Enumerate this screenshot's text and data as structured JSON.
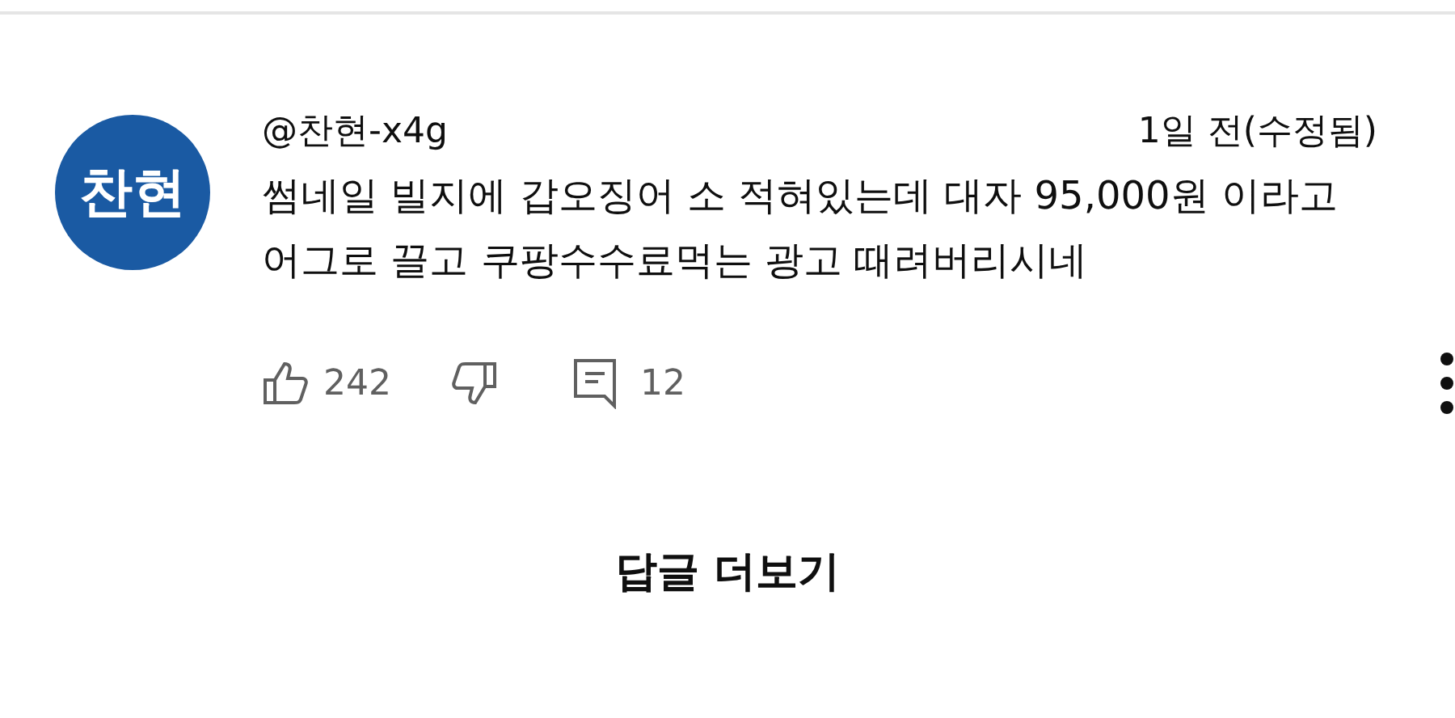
{
  "comment": {
    "avatar_text": "찬현",
    "author": "@찬현-x4g",
    "time": "1일 전(수정됨)",
    "text": "썸네일 빌지에 갑오징어 소 적혀있는데 대자 95,000원 이라고 어그로 끌고 쿠팡수수료먹는 광고 때려버리시네",
    "likes": "242",
    "replies": "12"
  },
  "more_replies_button": "답글 더보기"
}
